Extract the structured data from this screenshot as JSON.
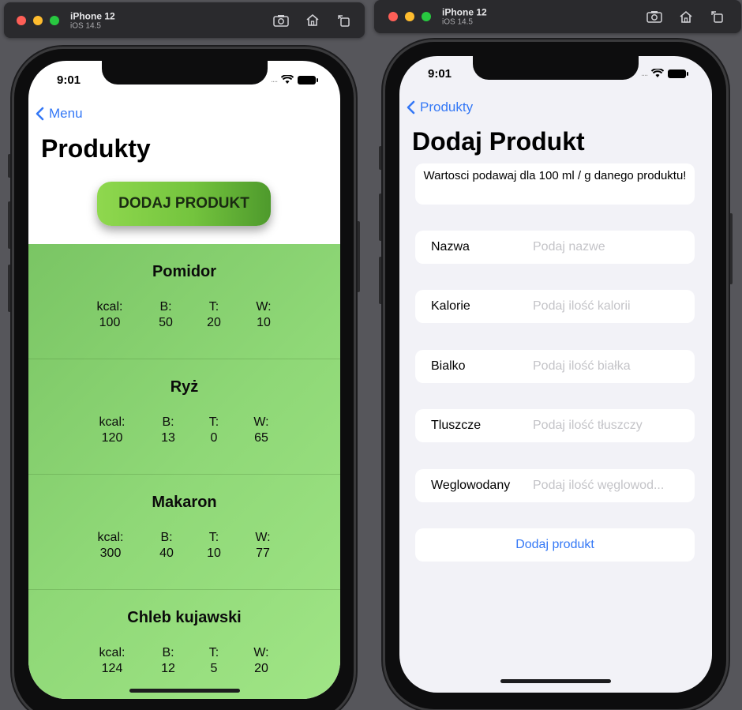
{
  "simulators": [
    {
      "device": "iPhone 12",
      "os": "iOS 14.5"
    },
    {
      "device": "iPhone 12",
      "os": "iOS 14.5"
    }
  ],
  "toolbar_icons": [
    "screenshot-icon",
    "home-icon",
    "rotate-icon"
  ],
  "status_time": "9:01",
  "products_screen": {
    "back_label": "Menu",
    "title": "Produkty",
    "add_button": "DODAJ PRODUKT",
    "macro_labels": {
      "kcal": "kcal:",
      "protein": "B:",
      "fat": "T:",
      "carbs": "W:"
    },
    "products": [
      {
        "name": "Pomidor",
        "kcal": "100",
        "protein": "50",
        "fat": "20",
        "carbs": "10"
      },
      {
        "name": "Ryż",
        "kcal": "120",
        "protein": "13",
        "fat": "0",
        "carbs": "65"
      },
      {
        "name": "Makaron",
        "kcal": "300",
        "protein": "40",
        "fat": "10",
        "carbs": "77"
      },
      {
        "name": "Chleb kujawski",
        "kcal": "124",
        "protein": "12",
        "fat": "5",
        "carbs": "20"
      }
    ]
  },
  "add_screen": {
    "back_label": "Produkty",
    "title": "Dodaj Produkt",
    "notice": "Wartosci podawaj dla 100 ml / g danego produktu!",
    "fields": [
      {
        "label": "Nazwa",
        "placeholder": "Podaj nazwe",
        "value": ""
      },
      {
        "label": "Kalorie",
        "placeholder": "Podaj ilość kalorii",
        "value": ""
      },
      {
        "label": "Bialko",
        "placeholder": "Podaj ilość białka",
        "value": ""
      },
      {
        "label": "Tluszcze",
        "placeholder": "Podaj ilość tłuszczy",
        "value": ""
      },
      {
        "label": "Weglowodany",
        "placeholder": "Podaj ilość węglowod...",
        "value": ""
      }
    ],
    "submit_label": "Dodaj produkt"
  },
  "colors": {
    "accent": "#3478f6",
    "card_green": "#8fd877",
    "button_green": "#74c43e"
  }
}
